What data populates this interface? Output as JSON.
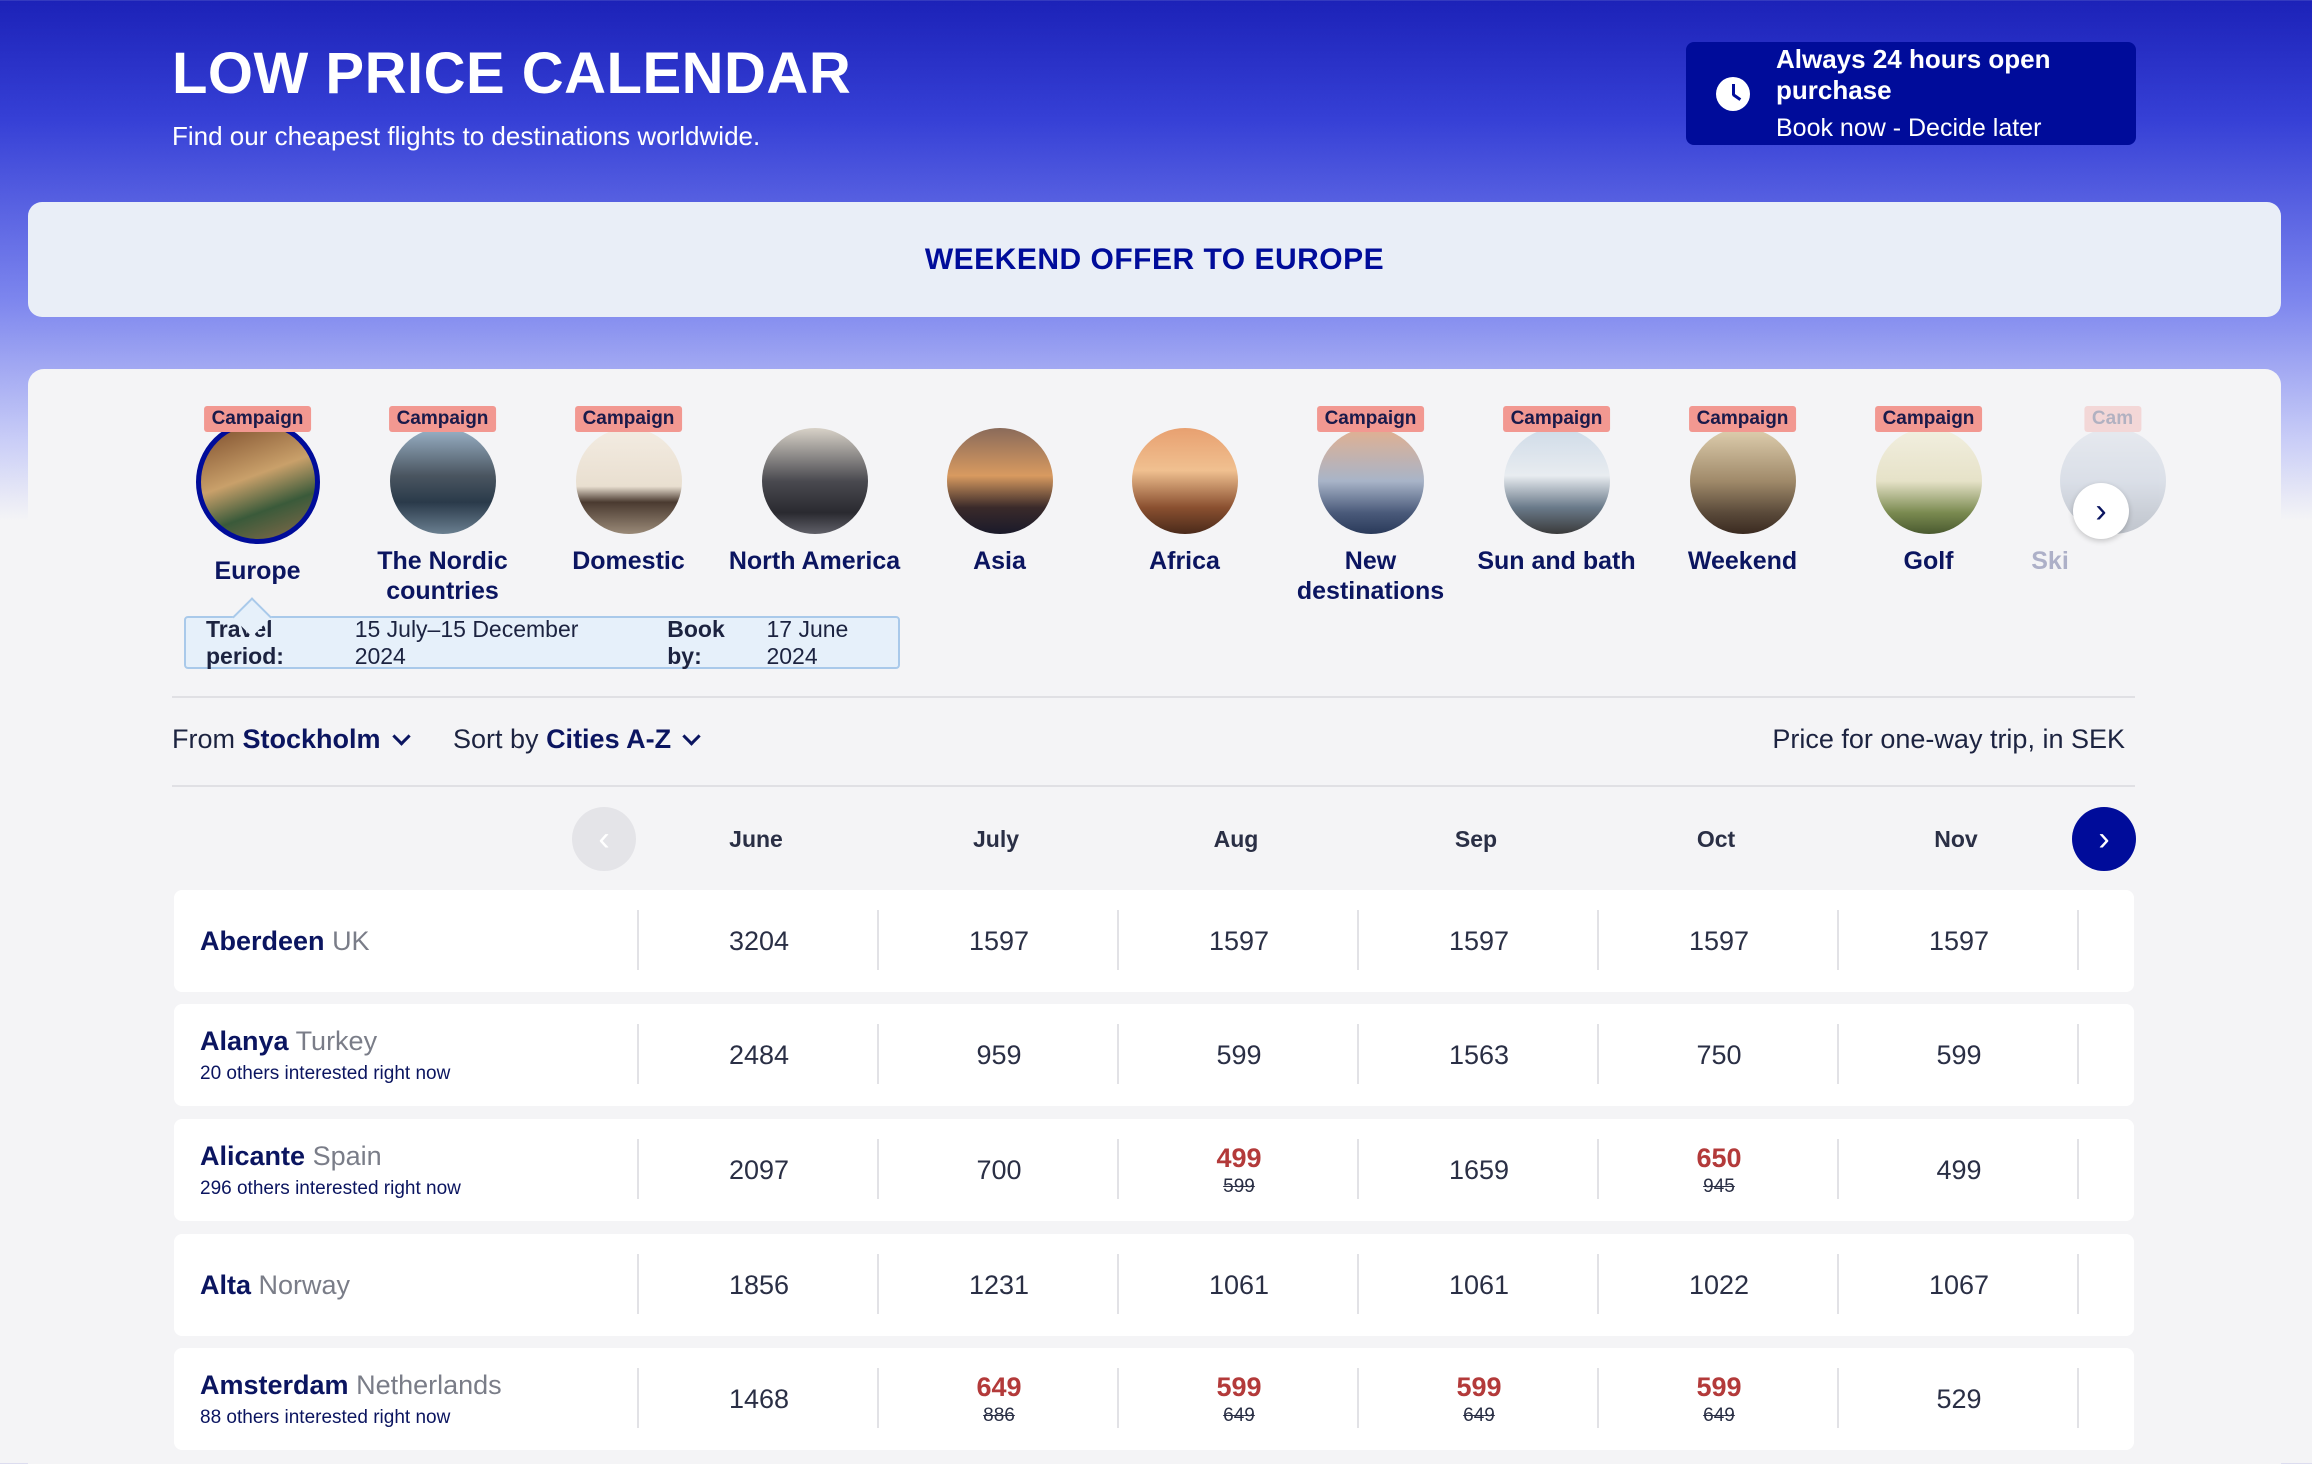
{
  "header": {
    "title": "LOW PRICE CALENDAR",
    "subtitle": "Find our cheapest flights to destinations worldwide."
  },
  "promo": {
    "line1": "Always 24 hours open purchase",
    "line2": "Book now - Decide later",
    "icon": "clock-icon"
  },
  "banner": "WEEKEND OFFER TO EUROPE",
  "categories": [
    {
      "label": "Europe",
      "badge": "Campaign",
      "active": true
    },
    {
      "label": "The Nordic countries",
      "badge": "Campaign"
    },
    {
      "label": "Domestic",
      "badge": "Campaign"
    },
    {
      "label": "North America",
      "badge": ""
    },
    {
      "label": "Asia",
      "badge": ""
    },
    {
      "label": "Africa",
      "badge": ""
    },
    {
      "label": "New destinations",
      "badge": "Campaign"
    },
    {
      "label": "Sun and bath",
      "badge": "Campaign"
    },
    {
      "label": "Weekend",
      "badge": "Campaign"
    },
    {
      "label": "Golf",
      "badge": "Campaign"
    },
    {
      "label": "Ski",
      "badge": "Cam"
    }
  ],
  "travel": {
    "period_label": "Travel period:",
    "period_value": "15 July–15 December 2024",
    "bookby_label": "Book by:",
    "bookby_value": "17 June 2024"
  },
  "filters": {
    "from_label": "From",
    "from_value": "Stockholm",
    "sort_label": "Sort by",
    "sort_value": "Cities A-Z",
    "price_note": "Price for one-way trip, in SEK"
  },
  "months": [
    "June",
    "July",
    "Aug",
    "Sep",
    "Oct",
    "Nov"
  ],
  "rows": [
    {
      "city": "Aberdeen",
      "country": "UK",
      "interest": "",
      "prices": [
        {
          "p": "3204"
        },
        {
          "p": "1597"
        },
        {
          "p": "1597"
        },
        {
          "p": "1597"
        },
        {
          "p": "1597"
        },
        {
          "p": "1597"
        }
      ]
    },
    {
      "city": "Alanya",
      "country": "Turkey",
      "interest": "20 others interested right now",
      "prices": [
        {
          "p": "2484"
        },
        {
          "p": "959"
        },
        {
          "p": "599"
        },
        {
          "p": "1563"
        },
        {
          "p": "750"
        },
        {
          "p": "599"
        }
      ]
    },
    {
      "city": "Alicante",
      "country": "Spain",
      "interest": "296 others interested right now",
      "prices": [
        {
          "p": "2097"
        },
        {
          "p": "700"
        },
        {
          "p": "499",
          "old": "599"
        },
        {
          "p": "1659"
        },
        {
          "p": "650",
          "old": "945"
        },
        {
          "p": "499"
        }
      ]
    },
    {
      "city": "Alta",
      "country": "Norway",
      "interest": "",
      "prices": [
        {
          "p": "1856"
        },
        {
          "p": "1231"
        },
        {
          "p": "1061"
        },
        {
          "p": "1061"
        },
        {
          "p": "1022"
        },
        {
          "p": "1067"
        }
      ]
    },
    {
      "city": "Amsterdam",
      "country": "Netherlands",
      "interest": "88 others interested right now",
      "prices": [
        {
          "p": "1468"
        },
        {
          "p": "649",
          "old": "886"
        },
        {
          "p": "599",
          "old": "649"
        },
        {
          "p": "599",
          "old": "649"
        },
        {
          "p": "599",
          "old": "649"
        },
        {
          "p": "529"
        }
      ]
    }
  ]
}
